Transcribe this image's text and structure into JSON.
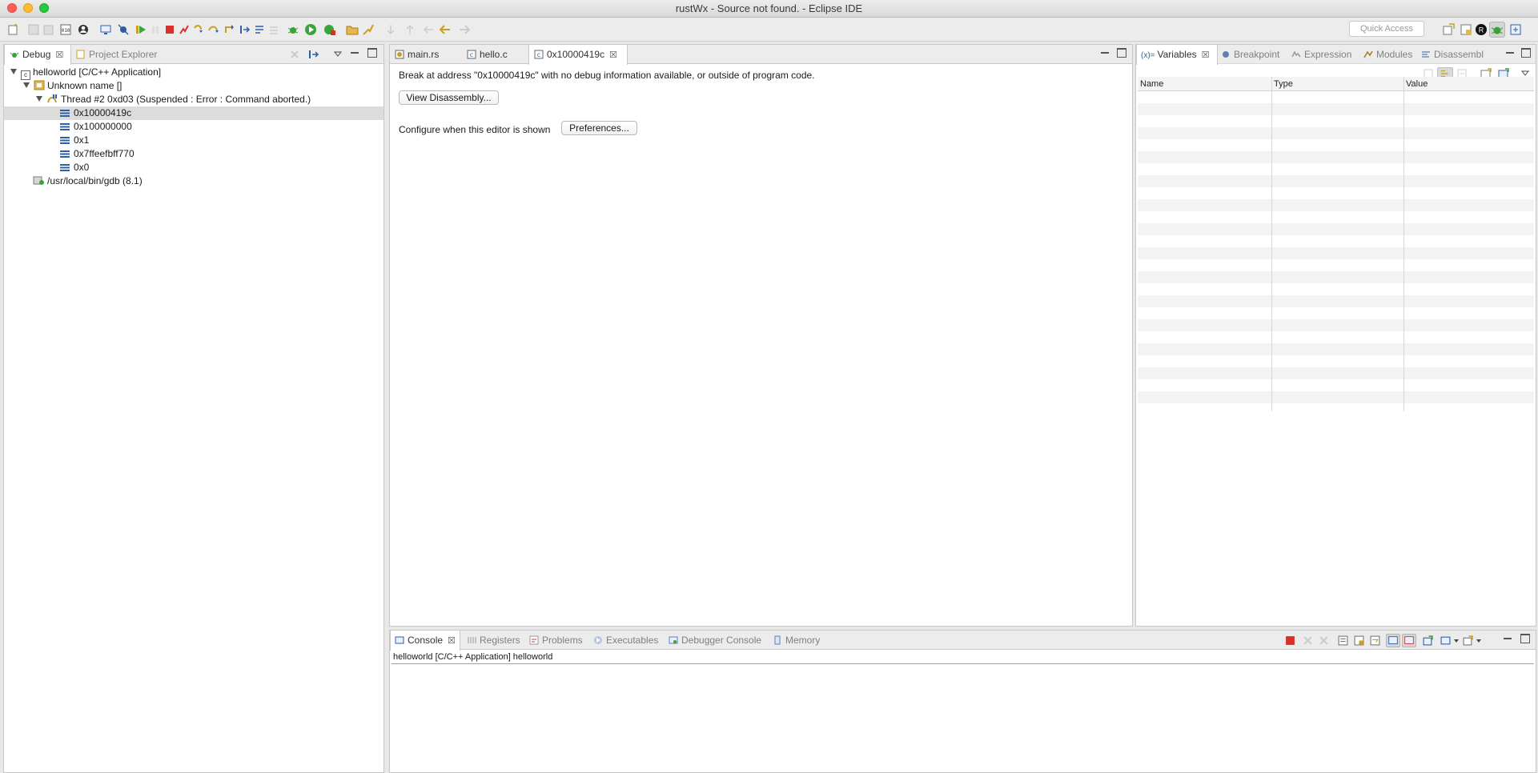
{
  "window": {
    "title": "rustWx - Source not found. - Eclipse IDE"
  },
  "toolbar": {
    "quick_access_placeholder": "Quick Access"
  },
  "debug_panel": {
    "tabs": [
      {
        "label": "Debug",
        "close": "☒"
      },
      {
        "label": "Project Explorer"
      }
    ],
    "tree": {
      "app": "helloworld [C/C++ Application]",
      "process": "Unknown name []",
      "thread": "Thread #2 0xd03 (Suspended : Error : Command aborted.)",
      "frames": [
        "0x10000419c",
        "0x100000000",
        "0x1",
        "0x7ffeefbff770",
        "0x0"
      ],
      "gdb": "/usr/local/bin/gdb (8.1)"
    }
  },
  "editor": {
    "tabs": [
      {
        "label": "main.rs"
      },
      {
        "label": "hello.c"
      },
      {
        "label": "0x10000419c",
        "close": "☒"
      }
    ],
    "message": "Break at address \"0x10000419c\" with no debug information available, or outside of program code.",
    "view_disassembly_label": "View Disassembly...",
    "configure_label": "Configure when this editor is shown",
    "preferences_label": "Preferences..."
  },
  "variables_panel": {
    "tabs": [
      {
        "label": "Variables",
        "icon_text": "(x)=",
        "close": "☒"
      },
      {
        "label": "Breakpoint"
      },
      {
        "label": "Expression"
      },
      {
        "label": "Modules"
      },
      {
        "label": "Disassembl"
      }
    ],
    "columns": [
      "Name",
      "Type",
      "Value"
    ]
  },
  "console_panel": {
    "tabs": [
      {
        "label": "Console",
        "close": "☒"
      },
      {
        "label": "Registers"
      },
      {
        "label": "Problems"
      },
      {
        "label": "Executables"
      },
      {
        "label": "Debugger Console"
      },
      {
        "label": "Memory"
      }
    ],
    "line": "helloworld [C/C++ Application] helloworld"
  },
  "colors": {
    "accent": "#2f5fa3",
    "stop": "#d9302a",
    "run": "#3aa43a"
  }
}
